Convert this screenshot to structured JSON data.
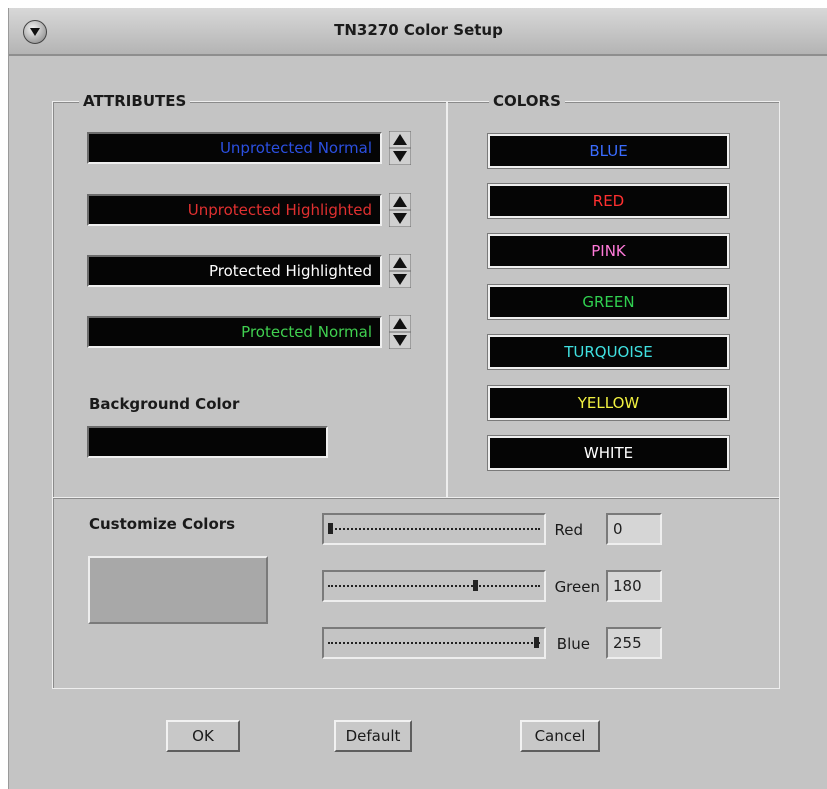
{
  "window": {
    "title": "TN3270 Color Setup",
    "menu_icon": "window-menu-icon"
  },
  "attributes": {
    "legend": "ATTRIBUTES",
    "items": [
      {
        "label": "Unprotected Normal",
        "color": "#2b4fe0"
      },
      {
        "label": "Unprotected Highlighted",
        "color": "#e03030"
      },
      {
        "label": "Protected Highlighted",
        "color": "#ffffff"
      },
      {
        "label": "Protected Normal",
        "color": "#40d050"
      }
    ],
    "spinner_icon": "spinner-arrows-icon"
  },
  "background": {
    "label": "Background Color",
    "color": "#050505"
  },
  "colors": {
    "legend": "COLORS",
    "items": [
      {
        "label": "BLUE",
        "color": "#3a6cff"
      },
      {
        "label": "RED",
        "color": "#ff3030"
      },
      {
        "label": "PINK",
        "color": "#ff7ad9"
      },
      {
        "label": "GREEN",
        "color": "#30d050"
      },
      {
        "label": "TURQUOISE",
        "color": "#40e0e0"
      },
      {
        "label": "YELLOW",
        "color": "#f0f040"
      },
      {
        "label": "WHITE",
        "color": "#ffffff"
      }
    ]
  },
  "customize": {
    "label": "Customize Colors",
    "preview_color": "#a8a8a8",
    "sliders": [
      {
        "label": "Red",
        "value": "0",
        "fraction": 0.0
      },
      {
        "label": "Green",
        "value": "180",
        "fraction": 0.706
      },
      {
        "label": "Blue",
        "value": "255",
        "fraction": 1.0
      }
    ]
  },
  "buttons": {
    "ok": "OK",
    "default": "Default",
    "cancel": "Cancel"
  }
}
